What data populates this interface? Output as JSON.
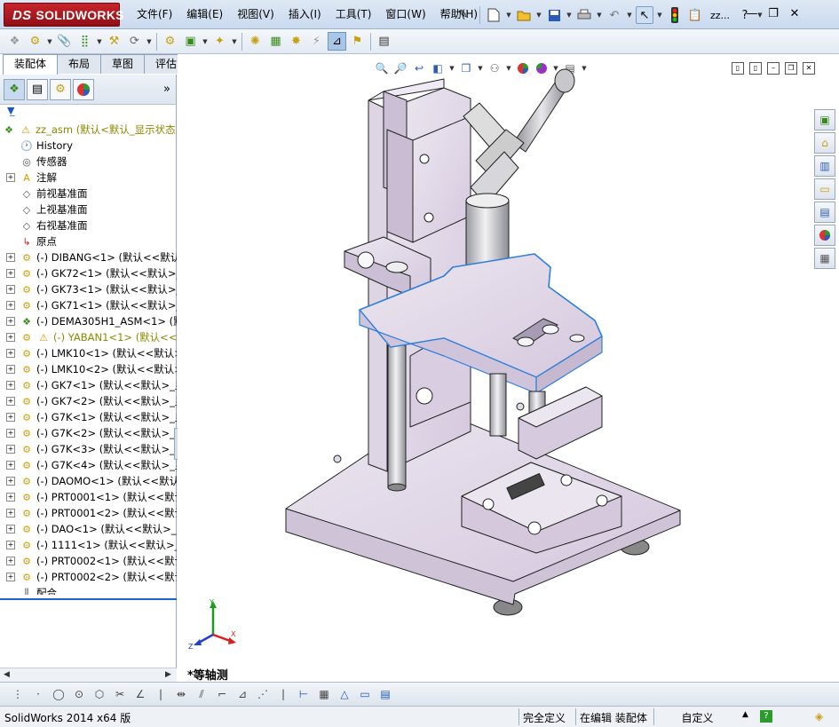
{
  "app": {
    "brand": "SOLIDWORKS",
    "brand_prefix": "DS",
    "doc_name": "zz..."
  },
  "menu": [
    "文件(F)",
    "编辑(E)",
    "视图(V)",
    "插入(I)",
    "工具(T)",
    "窗口(W)",
    "帮助(H)"
  ],
  "tabs": [
    "装配体",
    "布局",
    "草图",
    "评估"
  ],
  "tree": {
    "root": "zz_asm  (默认<默认_显示状态",
    "items": [
      {
        "label": "History",
        "icon": "history-icon",
        "expand": false
      },
      {
        "label": "传感器",
        "icon": "sensor-icon",
        "expand": false
      },
      {
        "label": "注解",
        "icon": "annotation-icon",
        "expand": true
      },
      {
        "label": "前视基准面",
        "icon": "plane-icon",
        "expand": false
      },
      {
        "label": "上视基准面",
        "icon": "plane-icon",
        "expand": false
      },
      {
        "label": "右视基准面",
        "icon": "plane-icon",
        "expand": false
      },
      {
        "label": "原点",
        "icon": "origin-icon",
        "expand": false
      },
      {
        "label": "(-) DIBANG<1> (默认<<默认>",
        "icon": "part-icon",
        "expand": true
      },
      {
        "label": "(-) GK72<1> (默认<<默认>_显",
        "icon": "part-icon",
        "expand": true
      },
      {
        "label": "(-) GK73<1> (默认<<默认>_显",
        "icon": "part-icon",
        "expand": true
      },
      {
        "label": "(-) GK71<1> (默认<<默认>_显",
        "icon": "part-icon",
        "expand": true
      },
      {
        "label": "(-) DEMA305H1_ASM<1> (默认",
        "icon": "assembly-icon",
        "expand": true
      },
      {
        "label": "(-) YABAN1<1> (默认<<默",
        "icon": "warning-icon",
        "expand": true,
        "warn": true
      },
      {
        "label": "(-) LMK10<1> (默认<<默认>_",
        "icon": "part-icon",
        "expand": true
      },
      {
        "label": "(-) LMK10<2> (默认<<默认>_",
        "icon": "part-icon",
        "expand": true
      },
      {
        "label": "(-) GK7<1> (默认<<默认>_显",
        "icon": "part-icon",
        "expand": true
      },
      {
        "label": "(-) GK7<2> (默认<<默认>_显",
        "icon": "part-icon",
        "expand": true
      },
      {
        "label": "(-) G7K<1> (默认<<默认>_显",
        "icon": "part-icon",
        "expand": true
      },
      {
        "label": "(-) G7K<2> (默认<<默认>_显",
        "icon": "part-icon",
        "expand": true
      },
      {
        "label": "(-) G7K<3> (默认<<默认>_显",
        "icon": "part-icon",
        "expand": true
      },
      {
        "label": "(-) G7K<4> (默认<<默认>_显",
        "icon": "part-icon",
        "expand": true
      },
      {
        "label": "(-) DAOMO<1> (默认<<默认>",
        "icon": "part-icon",
        "expand": true
      },
      {
        "label": "(-) PRT0001<1> (默认<<默认",
        "icon": "part-icon",
        "expand": true
      },
      {
        "label": "(-) PRT0001<2> (默认<<默认",
        "icon": "part-icon",
        "expand": true
      },
      {
        "label": "(-) DAO<1> (默认<<默认>_显",
        "icon": "part-icon",
        "expand": true
      },
      {
        "label": "(-) 1111<1> (默认<<默认>_显",
        "icon": "part-icon",
        "expand": true
      },
      {
        "label": "(-) PRT0002<1> (默认<<默认",
        "icon": "part-icon",
        "expand": true
      },
      {
        "label": "(-) PRT0002<2> (默认<<默认",
        "icon": "part-icon",
        "expand": true
      },
      {
        "label": "配合",
        "icon": "mate-icon",
        "expand": false
      }
    ]
  },
  "viewport": {
    "view_name": "*等轴测",
    "triad": {
      "x": "X",
      "y": "Y",
      "z": "Z"
    }
  },
  "status": {
    "product": "SolidWorks 2014 x64 版",
    "definition": "完全定义",
    "editing": "在编辑 装配体",
    "units": "自定义"
  },
  "colors": {
    "part_fill": "#d8cde0",
    "part_top": "#ece8f0",
    "highlight": "#2f7fd8",
    "steel": "#c9c9cf"
  }
}
